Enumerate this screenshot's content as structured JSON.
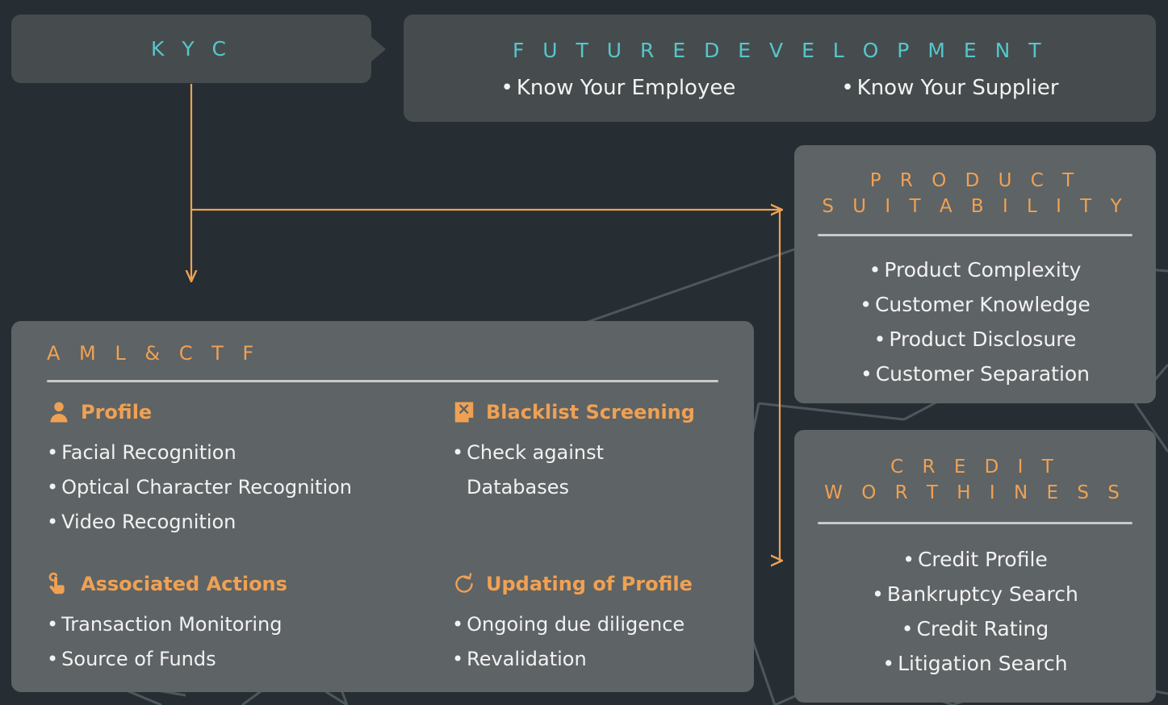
{
  "colors": {
    "background": "#262e33",
    "panel_dark": "#464c4d",
    "panel_light": "#5e6365",
    "accent_teal": "#56c6cc",
    "accent_orange": "#efa153",
    "text_light": "#f2f2f2",
    "divider": "#c9c9c9",
    "network_line": "#707a7e"
  },
  "kyc": {
    "title": "K Y C"
  },
  "future": {
    "title": "F U T U R E   D E V E L O P M E N T",
    "items": [
      "Know Your Employee",
      "Know Your Supplier"
    ]
  },
  "product": {
    "title_line1": "P R O D U C T",
    "title_line2": "S U I T A B I L I T Y",
    "items": [
      "Product Complexity",
      "Customer Knowledge",
      "Product Disclosure",
      "Customer Separation"
    ]
  },
  "credit": {
    "title_line1": "C R E D I T",
    "title_line2": "W O R T H I N E S S",
    "items": [
      "Credit Profile",
      "Bankruptcy Search",
      "Credit Rating",
      "Litigation Search"
    ]
  },
  "aml": {
    "title": "A M L  &  C T F",
    "sections": [
      {
        "icon": "user-profile-icon",
        "label": "Profile",
        "items": [
          "Facial Recognition",
          "Optical Character Recognition",
          "Video Recognition"
        ]
      },
      {
        "icon": "document-x-icon",
        "label": "Blacklist Screening",
        "items": [
          "Check against",
          "Databases"
        ]
      },
      {
        "icon": "hand-tap-icon",
        "label": "Associated Actions",
        "items": [
          "Transaction Monitoring",
          "Source of Funds"
        ]
      },
      {
        "icon": "refresh-circle-icon",
        "label": "Updating of Profile",
        "items": [
          "Ongoing due diligence",
          "Revalidation"
        ]
      }
    ]
  },
  "bullet": "•"
}
